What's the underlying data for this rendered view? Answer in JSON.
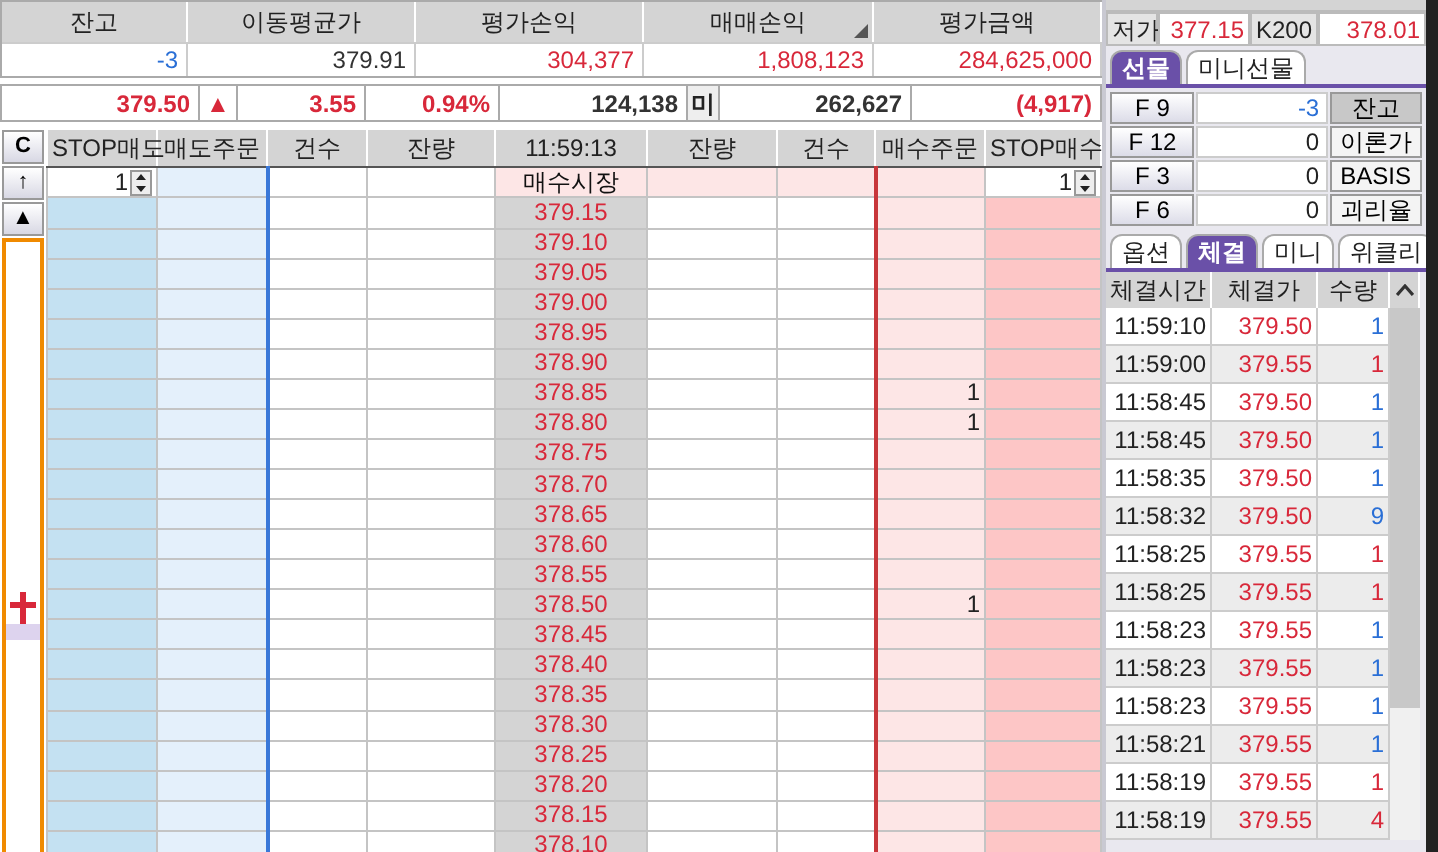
{
  "summary": {
    "columns": [
      {
        "label": "잔고",
        "value": "-3",
        "color": "#2a6fd6"
      },
      {
        "label": "이동평균가",
        "value": "379.91",
        "color": "#333333"
      },
      {
        "label": "평가손익",
        "value": "304,377",
        "color": "#d8283a"
      },
      {
        "label": "매매손익",
        "value": "1,808,123",
        "color": "#d8283a"
      },
      {
        "label": "평가금액",
        "value": "284,625,000",
        "color": "#d8283a"
      }
    ]
  },
  "quote": {
    "cells": [
      {
        "text": "379.50",
        "color": "#d8283a",
        "kind": "value"
      },
      {
        "text": "▲",
        "color": "#d8283a",
        "kind": "sign"
      },
      {
        "text": "3.55",
        "color": "#d8283a",
        "kind": "value"
      },
      {
        "text": "0.94%",
        "color": "#d8283a",
        "kind": "value"
      },
      {
        "text": "124,138",
        "color": "#333333",
        "kind": "value"
      },
      {
        "text": "미",
        "color": "#222222",
        "kind": "label"
      },
      {
        "text": "262,627",
        "color": "#333333",
        "kind": "value"
      },
      {
        "text": "(4,917)",
        "color": "#d8283a",
        "kind": "value"
      }
    ]
  },
  "order_grid": {
    "side_buttons": [
      "C",
      "↑",
      "▲"
    ],
    "columns": [
      "STOP매도",
      "매도주문",
      "건수",
      "잔량",
      "11:59:13",
      "잔량",
      "건수",
      "매수주문",
      "STOP매수"
    ],
    "market_row": {
      "stop_sell_qty": "1",
      "label": "매수시장",
      "stop_buy_qty": "1"
    },
    "rows": [
      {
        "price": "379.15"
      },
      {
        "price": "379.10"
      },
      {
        "price": "379.05"
      },
      {
        "price": "379.00"
      },
      {
        "price": "378.95"
      },
      {
        "price": "378.90"
      },
      {
        "price": "378.85",
        "buy_order": "1"
      },
      {
        "price": "378.80",
        "buy_order": "1"
      },
      {
        "price": "378.75"
      },
      {
        "price": "378.70"
      },
      {
        "price": "378.65"
      },
      {
        "price": "378.60"
      },
      {
        "price": "378.55"
      },
      {
        "price": "378.50",
        "buy_order": "1"
      },
      {
        "price": "378.45"
      },
      {
        "price": "378.40"
      },
      {
        "price": "378.35"
      },
      {
        "price": "378.30"
      },
      {
        "price": "378.25"
      },
      {
        "price": "378.20"
      },
      {
        "price": "378.15"
      },
      {
        "price": "378.10"
      }
    ]
  },
  "price_info": {
    "cells": [
      {
        "text": "저가",
        "kind": "label"
      },
      {
        "text": "377.15",
        "kind": "value"
      },
      {
        "text": "K200",
        "kind": "label"
      },
      {
        "text": "378.01",
        "kind": "value"
      }
    ]
  },
  "product_tabs": [
    {
      "label": "선물",
      "selected": true
    },
    {
      "label": "미니선물",
      "selected": false
    }
  ],
  "contracts": [
    {
      "code": "F 9",
      "value": "-3",
      "color": "#2a6fd6",
      "action": "잔고",
      "pressed": true
    },
    {
      "code": "F 12",
      "value": "0",
      "color": "#222222",
      "action": "이론가",
      "pressed": false
    },
    {
      "code": "F 3",
      "value": "0",
      "color": "#222222",
      "action": "BASIS",
      "pressed": false
    },
    {
      "code": "F 6",
      "value": "0",
      "color": "#222222",
      "action": "괴리율",
      "pressed": false
    }
  ],
  "trade_tabs": [
    {
      "label": "옵션",
      "selected": false
    },
    {
      "label": "체결",
      "selected": true
    },
    {
      "label": "미니",
      "selected": false
    },
    {
      "label": "위클리",
      "selected": false
    }
  ],
  "trades": {
    "columns": [
      "체결시간",
      "체결가",
      "수량"
    ],
    "rows": [
      {
        "time": "11:59:10",
        "price": "379.50",
        "qty": "1",
        "color": "#2a6fd6"
      },
      {
        "time": "11:59:00",
        "price": "379.55",
        "qty": "1",
        "color": "#d8283a"
      },
      {
        "time": "11:58:45",
        "price": "379.50",
        "qty": "1",
        "color": "#2a6fd6"
      },
      {
        "time": "11:58:45",
        "price": "379.50",
        "qty": "1",
        "color": "#2a6fd6"
      },
      {
        "time": "11:58:35",
        "price": "379.50",
        "qty": "1",
        "color": "#2a6fd6"
      },
      {
        "time": "11:58:32",
        "price": "379.50",
        "qty": "9",
        "color": "#2a6fd6"
      },
      {
        "time": "11:58:25",
        "price": "379.55",
        "qty": "1",
        "color": "#d8283a"
      },
      {
        "time": "11:58:25",
        "price": "379.55",
        "qty": "1",
        "color": "#d8283a"
      },
      {
        "time": "11:58:23",
        "price": "379.55",
        "qty": "1",
        "color": "#2a6fd6"
      },
      {
        "time": "11:58:23",
        "price": "379.55",
        "qty": "1",
        "color": "#2a6fd6"
      },
      {
        "time": "11:58:23",
        "price": "379.55",
        "qty": "1",
        "color": "#2a6fd6"
      },
      {
        "time": "11:58:21",
        "price": "379.55",
        "qty": "1",
        "color": "#2a6fd6"
      },
      {
        "time": "11:58:19",
        "price": "379.55",
        "qty": "1",
        "color": "#d8283a"
      },
      {
        "time": "11:58:19",
        "price": "379.55",
        "qty": "4",
        "color": "#d8283a"
      }
    ]
  }
}
